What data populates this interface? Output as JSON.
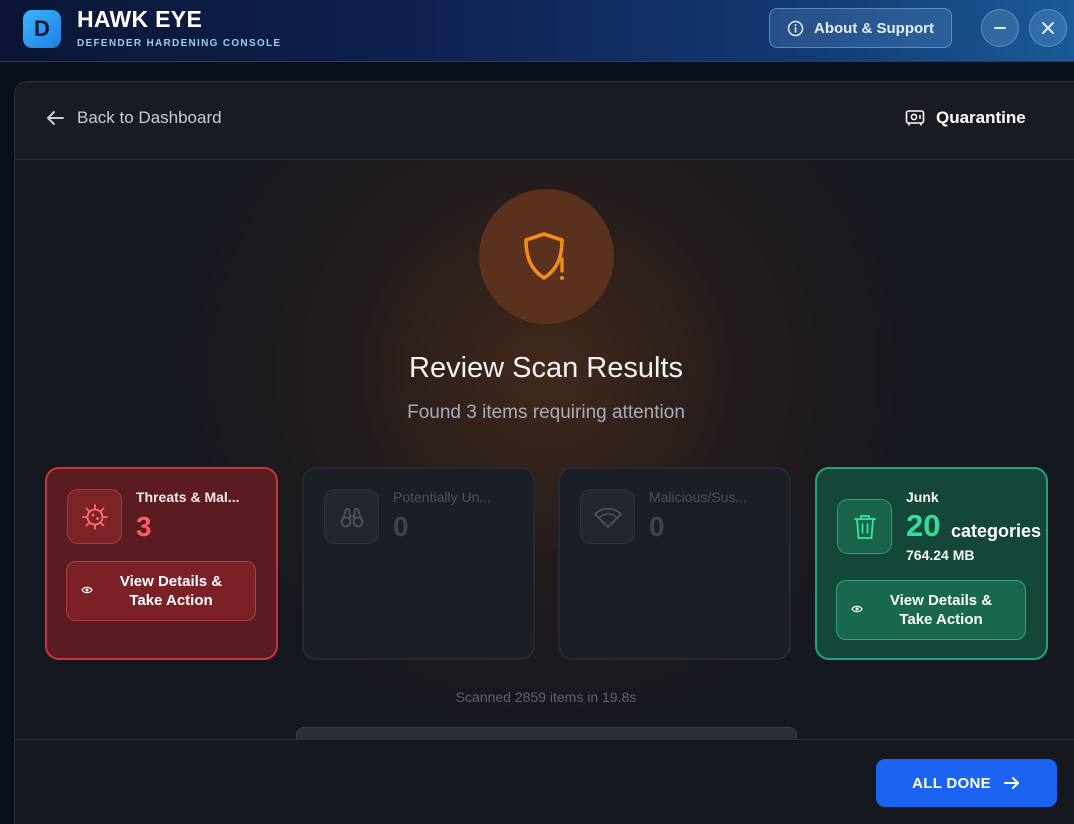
{
  "app": {
    "logo_letter": "D",
    "title": "HAWK EYE",
    "subtitle": "DEFENDER HARDENING CONSOLE",
    "about_label": "About & Support",
    "minimize_glyph": "–",
    "close_glyph": "✕"
  },
  "header": {
    "back_label": "Back to Dashboard",
    "quarantine_label": "Quarantine"
  },
  "hero": {
    "title": "Review Scan Results",
    "subtitle": "Found 3 items requiring attention"
  },
  "cards": [
    {
      "title": "Threats & Mal...",
      "count": "3",
      "action_label": "View Details & Take Action",
      "icon": "virus-icon",
      "color": "#ff5a5f"
    },
    {
      "title": "Potentially Un...",
      "count": "0",
      "icon": "binoculars-icon",
      "color": "#3e424d"
    },
    {
      "title": "Malicious/Sus...",
      "count": "0",
      "icon": "wifi-icon",
      "color": "#3e424d"
    },
    {
      "title": "Junk",
      "count": "20",
      "unit": "categories",
      "size": "764.24 MB",
      "action_label": "View Details & Take Action",
      "icon": "trash-icon",
      "color": "#2fe09a"
    }
  ],
  "scan": {
    "summary": "Scanned 2859 items in 19.8s"
  },
  "footer": {
    "done_label": "ALL DONE"
  },
  "colors": {
    "accent_blue": "#1d63f2",
    "threat_red": "#c8343a",
    "junk_green": "#1fa57a",
    "warning_orange": "#f28a1e"
  }
}
